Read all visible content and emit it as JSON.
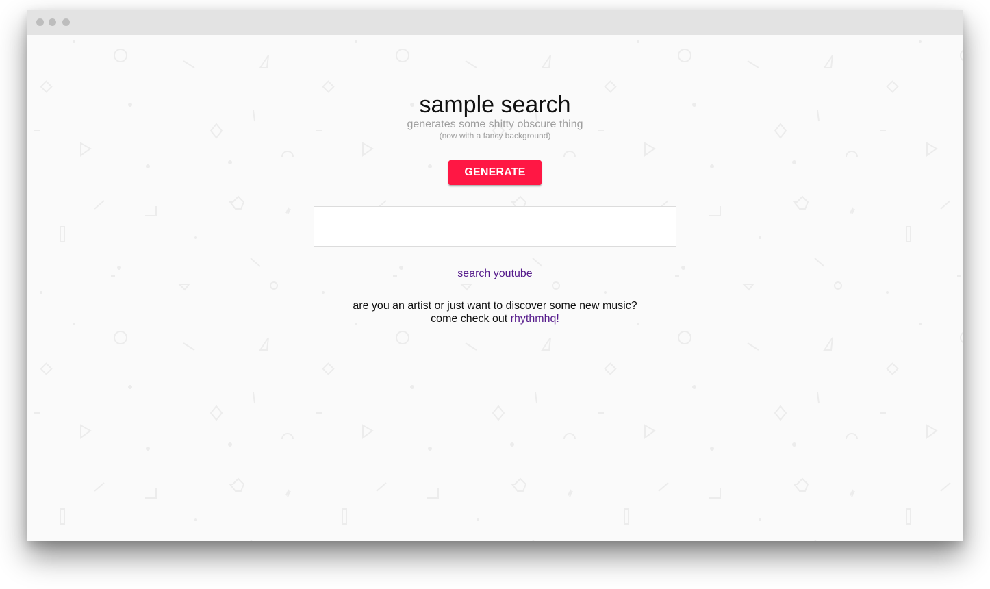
{
  "page": {
    "title": "sample search",
    "subtitle": "generates some shitty obscure thing",
    "note": "(now with a fancy background)"
  },
  "generate_button": {
    "label": "GENERATE"
  },
  "result_box": {
    "value": ""
  },
  "search_link": {
    "label": "search youtube"
  },
  "promo": {
    "line1": "are you an artist or just want to discover some new music?",
    "line2_prefix": "come check out ",
    "link_label": "rhythmhq!"
  },
  "colors": {
    "accent": "#ff1744",
    "link": "#551a8b",
    "background": "#fafafa",
    "titlebar": "#e3e3e3"
  },
  "icons": {
    "window_controls": [
      "window-dot-icon",
      "window-dot-icon",
      "window-dot-icon"
    ],
    "background_shapes": [
      "circle-icon",
      "triangle-icon",
      "diamond-icon",
      "hexagon-icon",
      "lightning-icon",
      "dash-icon"
    ]
  }
}
